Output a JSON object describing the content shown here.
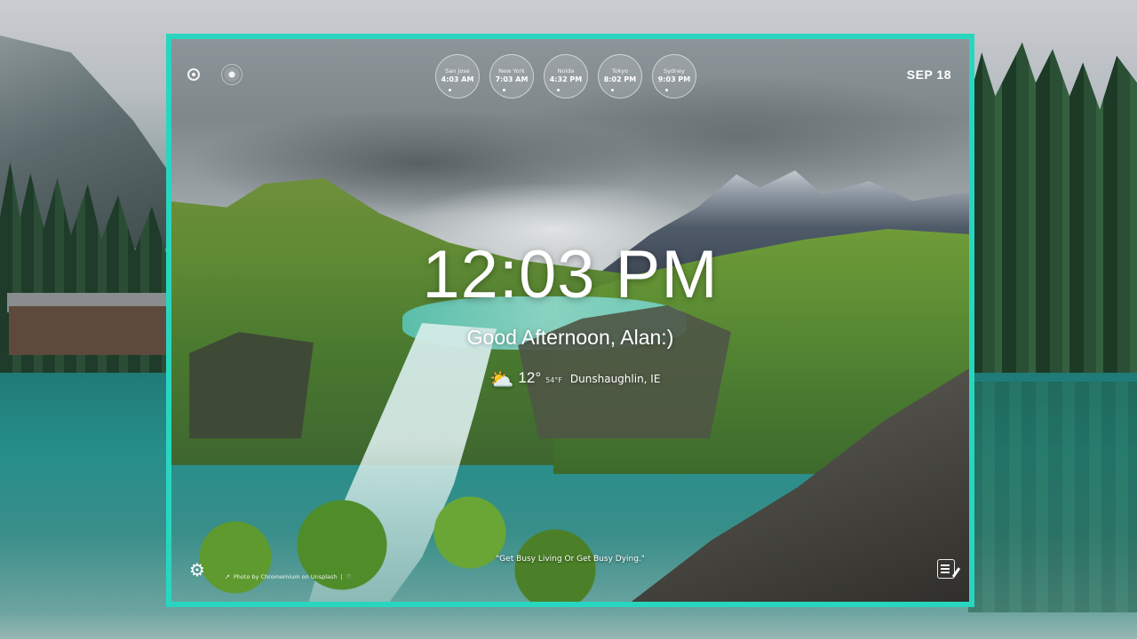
{
  "world_clocks": [
    {
      "city": "San Jose",
      "time": "4:03 AM"
    },
    {
      "city": "New York",
      "time": "7:03 AM"
    },
    {
      "city": "Noida",
      "time": "4:32 PM"
    },
    {
      "city": "Tokyo",
      "time": "8:02 PM"
    },
    {
      "city": "Sydney",
      "time": "9:03 PM"
    }
  ],
  "date": "SEP 18",
  "main_time": "12:03 PM",
  "greeting": "Good Afternoon, Alan:)",
  "weather": {
    "icon": "partly-cloudy-rain-icon",
    "temp_c": "12°",
    "temp_f": "54°F",
    "location": "Dunshaughlin, IE"
  },
  "quote": "\"Get Busy Living Or Get Busy Dying.\"",
  "photo_credit": {
    "text": "Photo by Chromemium on Unsplash",
    "separator": "|",
    "heart": "♡"
  },
  "colors": {
    "frame_border": "#28d6bf",
    "text": "#ffffff"
  }
}
